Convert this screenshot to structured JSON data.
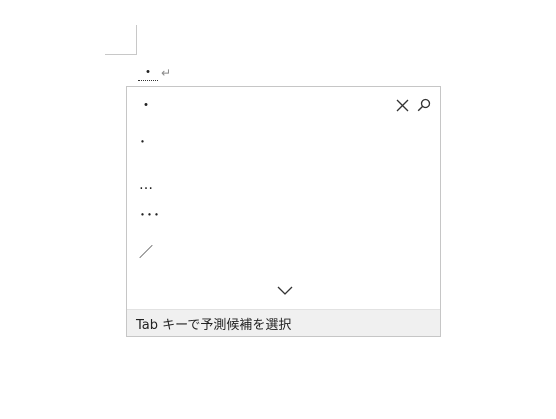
{
  "document": {
    "typed_text": "・",
    "paragraph_mark": "↵"
  },
  "popup": {
    "suggestions": [
      {
        "label": "・"
      },
      {
        "label": "･"
      },
      {
        "label": "…"
      },
      {
        "label": "･･･"
      },
      {
        "label": "／"
      }
    ],
    "close_icon": "close-icon",
    "search_icon": "search-icon",
    "more_icon": "chevron-down-icon",
    "footer_hint": "Tab キーで予測候補を選択"
  }
}
